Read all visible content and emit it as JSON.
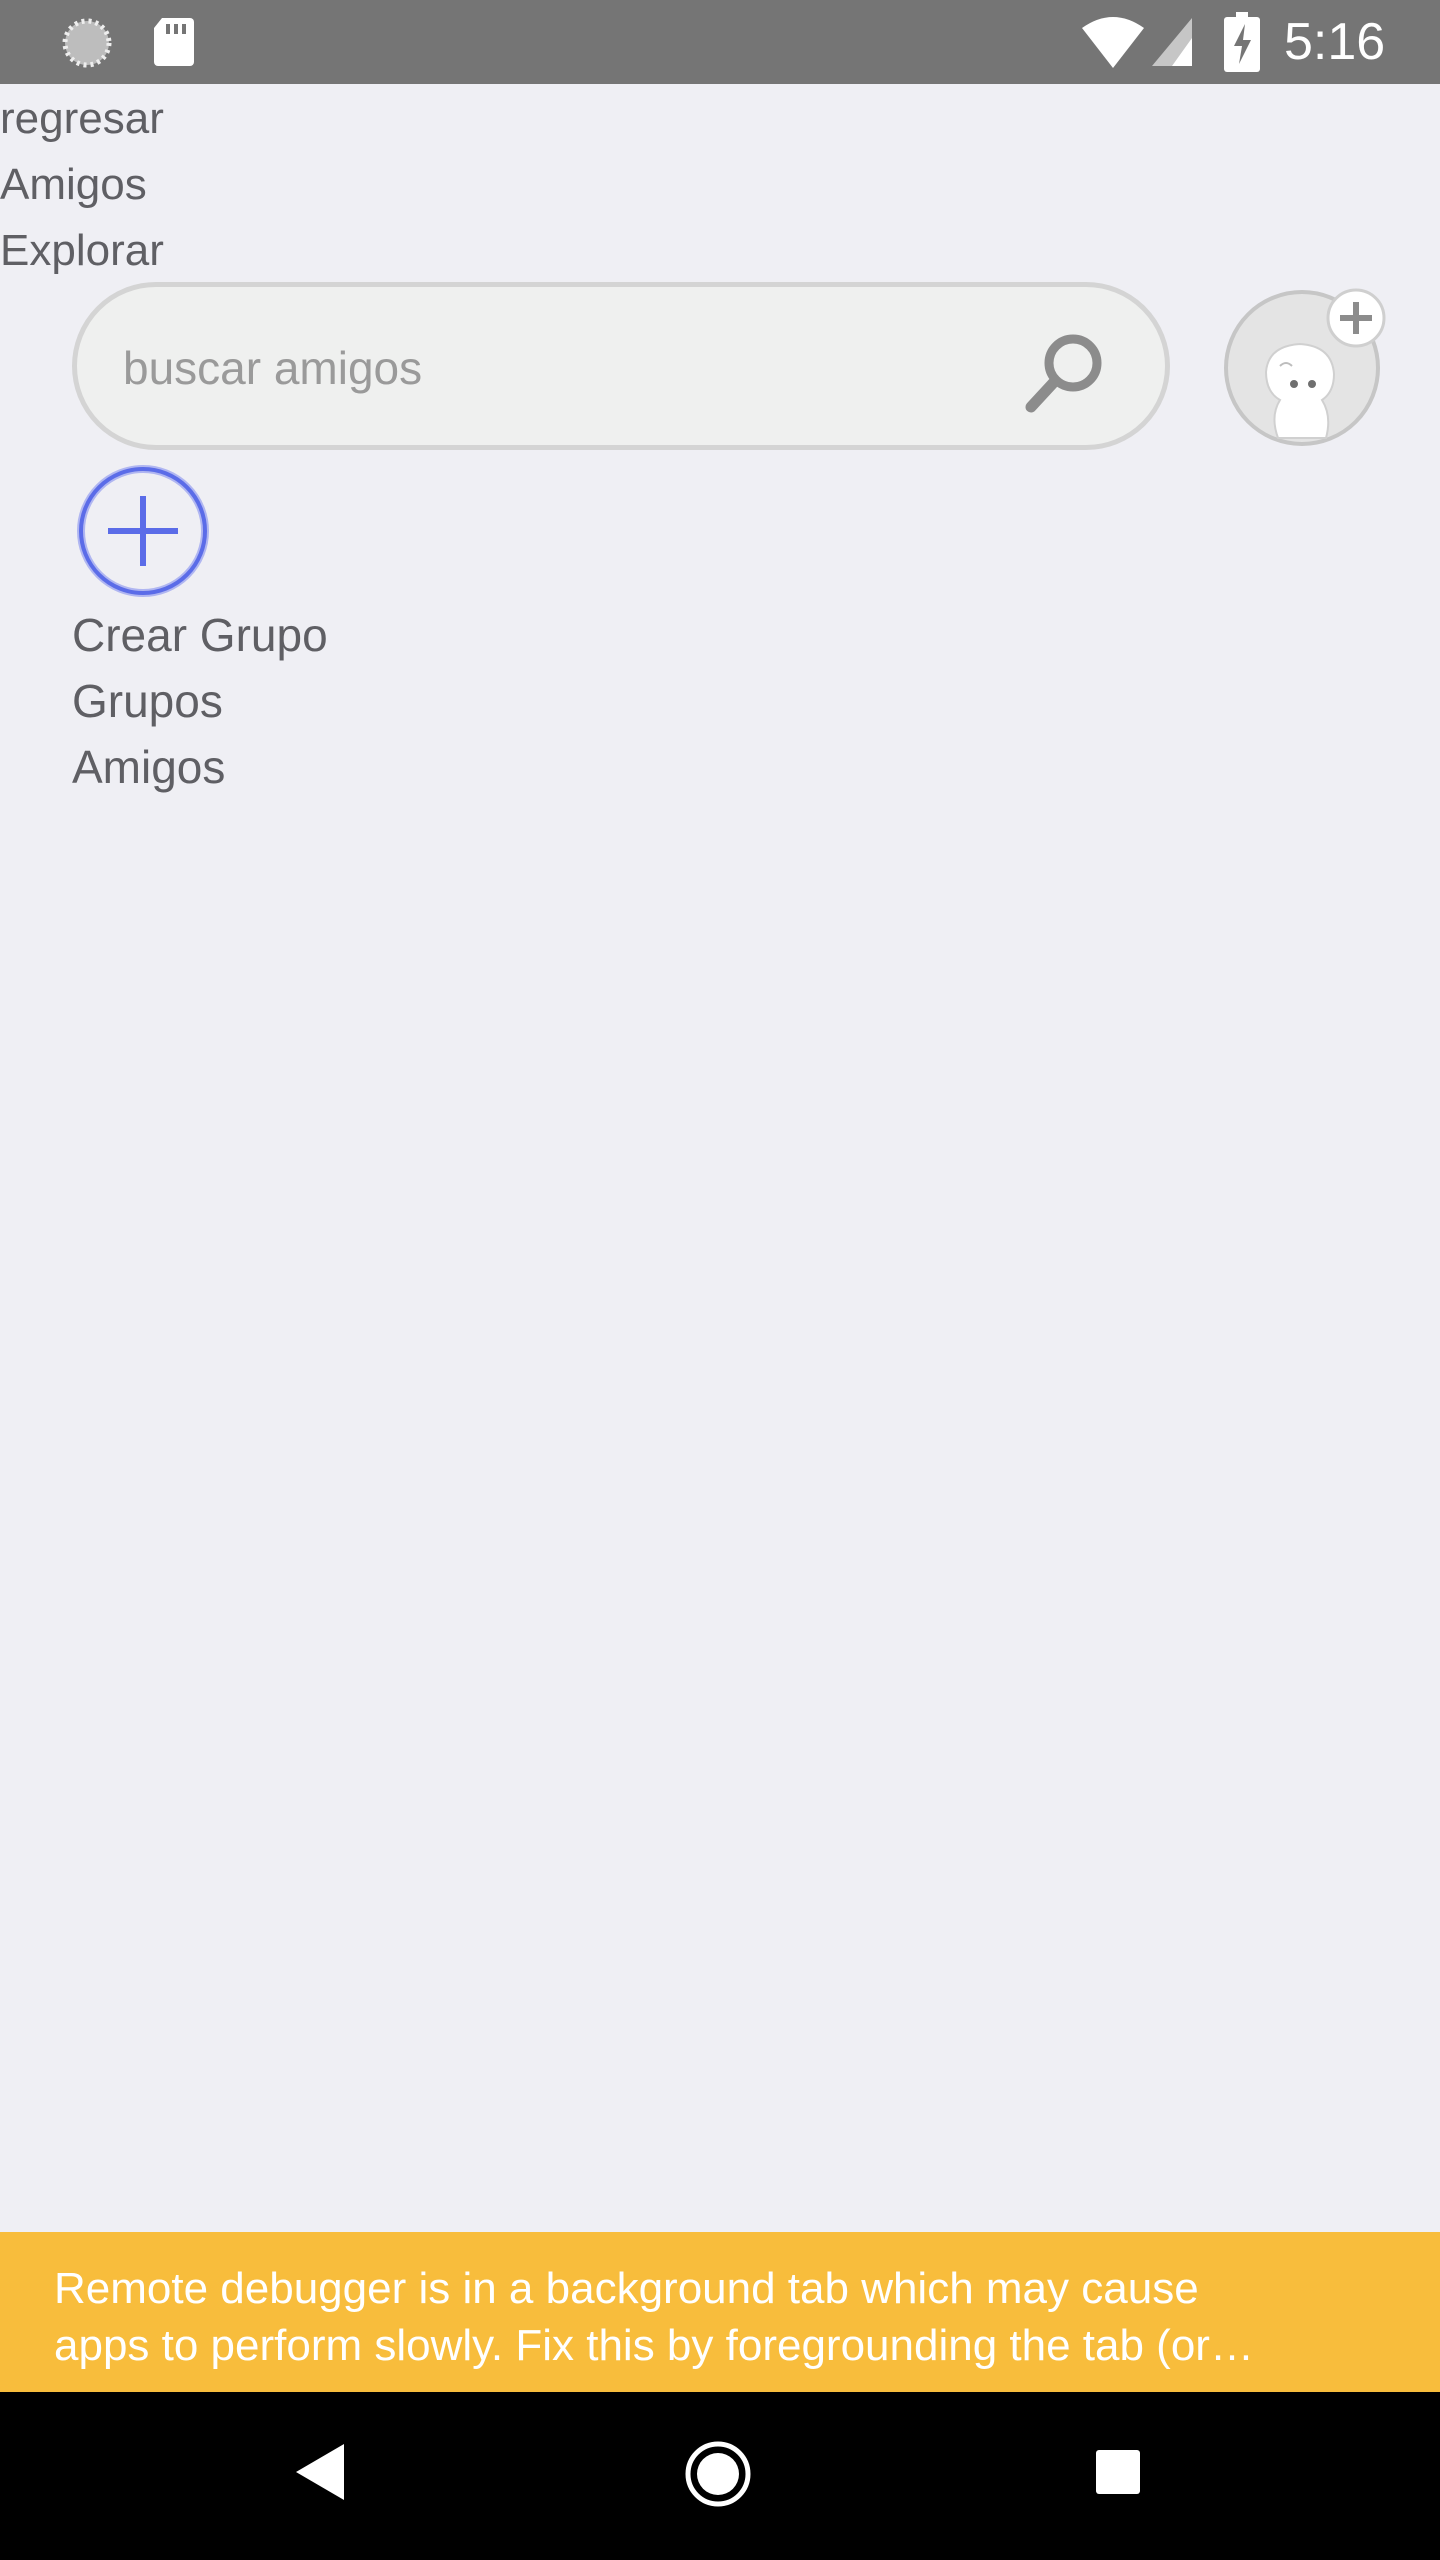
{
  "status_bar": {
    "time": "5:16",
    "icons": [
      "sync-icon",
      "sd-card-icon",
      "wifi-icon",
      "signal-icon",
      "battery-charging-icon"
    ]
  },
  "nav": {
    "back_label": "regresar",
    "title": "Amigos",
    "explore_label": "Explorar"
  },
  "search": {
    "placeholder": "buscar amigos",
    "value": "",
    "icon": "search-icon"
  },
  "add_friend": {
    "icon": "add-friend-avatar-icon"
  },
  "groups": {
    "create_icon": "plus-circle-icon",
    "create_label": "Crear Grupo",
    "heading": "Grupos"
  },
  "friends": {
    "heading": "Amigos"
  },
  "debug_banner": {
    "line1": "Remote debugger is in a background tab which may cause",
    "line2": "apps to perform slowly. Fix this by foregrounding the tab (or…"
  },
  "system_nav": {
    "icons": [
      "back-icon",
      "home-icon",
      "recents-icon"
    ]
  },
  "colors": {
    "background": "#efeff4",
    "status_bar": "#757575",
    "banner": "#f8bd3c",
    "accent_blue": "#5b6ce8",
    "text": "#5f5f64"
  }
}
